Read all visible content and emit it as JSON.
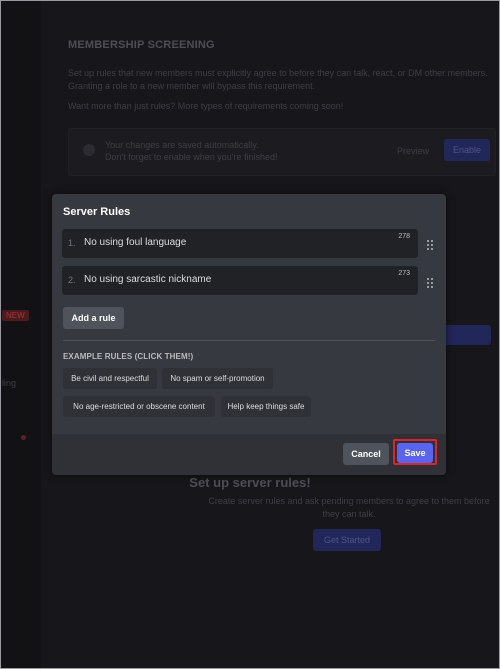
{
  "background": {
    "section_title": "MEMBERSHIP SCREENING",
    "description": "Set up rules that new members must explicitly agree to before they can talk, react, or DM other members. Granting a role to a new member will bypass this requirement.",
    "more_prompt": "Want more than just rules? More types of requirements coming soon!",
    "autosave_line1": "Your changes are saved automatically.",
    "autosave_line2": "Don't forget to enable when you're finished!",
    "preview_label": "Preview",
    "enable_label": "Enable",
    "new_badge": "NEW",
    "sidebar_partial": "ling",
    "setup_title": "Set up server rules!",
    "setup_desc": "Create server rules and ask pending members to agree to them before they can talk.",
    "get_started_label": "Get Started"
  },
  "modal": {
    "title": "Server Rules",
    "rules": [
      {
        "number": "1.",
        "text": "No using foul language",
        "count": "278"
      },
      {
        "number": "2.",
        "text": "No using sarcastic nickname",
        "count": "273"
      }
    ],
    "add_rule_label": "Add a rule",
    "examples_label": "EXAMPLE RULES (CLICK THEM!)",
    "examples": [
      "Be civil and respectful",
      "No spam or self-promotion",
      "No age-restricted or obscene content",
      "Help keep things safe"
    ],
    "cancel_label": "Cancel",
    "save_label": "Save"
  },
  "colors": {
    "modal_bg": "#36393f",
    "input_bg": "#202225",
    "accent": "#5865f2",
    "highlight": "#e0232a"
  },
  "icons": [
    "drag-handle-icon",
    "info-icon"
  ]
}
